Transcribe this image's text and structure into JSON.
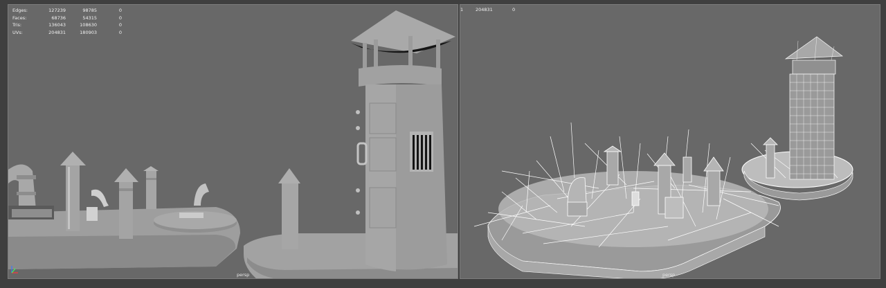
{
  "left_viewport": {
    "camera": "persp",
    "stats": [
      {
        "label": "Edges:",
        "v1": "127239",
        "v2": "98785",
        "v3": "0"
      },
      {
        "label": "Faces:",
        "v1": "68736",
        "v2": "54315",
        "v3": "0"
      },
      {
        "label": "Tris:",
        "v1": "136043",
        "v2": "108630",
        "v3": "0"
      },
      {
        "label": "UVs:",
        "v1": "204831",
        "v2": "180903",
        "v3": "0"
      }
    ]
  },
  "right_viewport": {
    "camera": "persp",
    "stats_partial": {
      "v0": "1",
      "v1": "204831",
      "v2": "0"
    }
  },
  "colors": {
    "viewport_bg": "#686868",
    "frame_bg": "#3f3f3f",
    "hud_text": "#f2f2f2",
    "wire": "#ffffff",
    "mesh": "#9a9a9a"
  }
}
